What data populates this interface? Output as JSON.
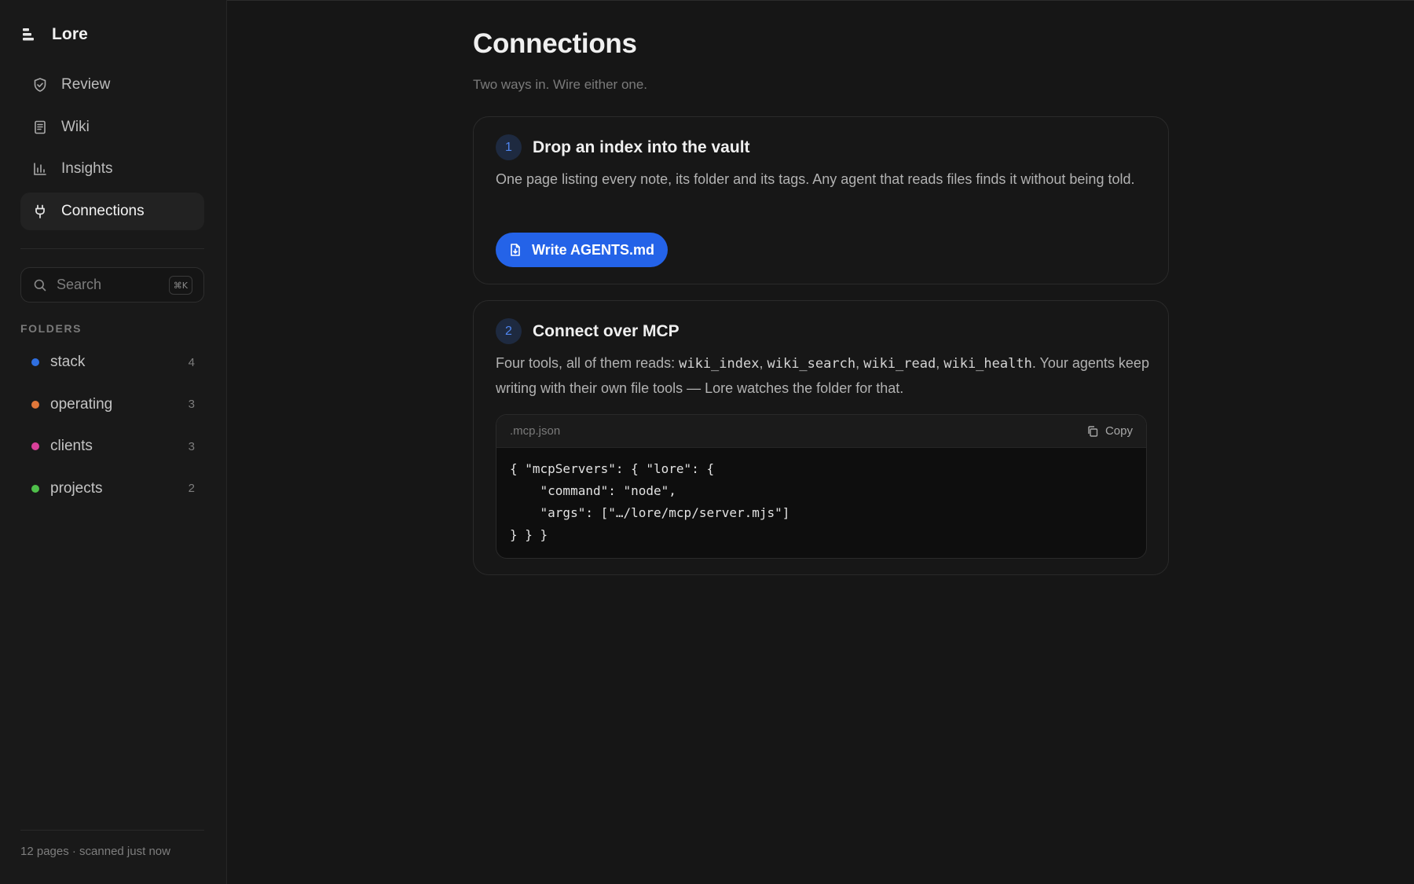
{
  "app": {
    "name": "Lore",
    "logo_icon": "stack-logo-icon"
  },
  "sidebar": {
    "nav": [
      {
        "label": "Review",
        "icon": "shield-check-icon",
        "active": false
      },
      {
        "label": "Wiki",
        "icon": "book-icon",
        "active": false
      },
      {
        "label": "Insights",
        "icon": "bar-chart-icon",
        "active": false
      },
      {
        "label": "Connections",
        "icon": "plug-icon",
        "active": true
      }
    ],
    "search": {
      "placeholder": "Search",
      "shortcut": "⌘K"
    },
    "folders_label": "FOLDERS",
    "folders": [
      {
        "name": "stack",
        "count": "4",
        "color": "#2f6fe0"
      },
      {
        "name": "operating",
        "count": "3",
        "color": "#e0773a"
      },
      {
        "name": "clients",
        "count": "3",
        "color": "#d9409a"
      },
      {
        "name": "projects",
        "count": "2",
        "color": "#4fbf4a"
      }
    ],
    "status": "12 pages · scanned just now"
  },
  "main": {
    "title": "Connections",
    "subtitle": "Two ways in. Wire either one.",
    "step1": {
      "number": "1",
      "title": "Drop an index into the vault",
      "body": "One page listing every note, its folder and its tags. Any agent that reads files finds it without being told.",
      "button_label": "Write AGENTS.md",
      "button_icon": "file-download-icon"
    },
    "step2": {
      "number": "2",
      "title": "Connect over MCP",
      "body_prefix": "Four tools, all of them reads: ",
      "tools": [
        "wiki_index",
        "wiki_search",
        "wiki_read",
        "wiki_health"
      ],
      "sep": ", ",
      "body_suffix": ". Your agents keep writing with their own file tools — Lore watches the folder for that.",
      "code_filename": ".mcp.json",
      "copy_label": "Copy",
      "copy_icon": "copy-icon",
      "code": "{ \"mcpServers\": { \"lore\": {\n    \"command\": \"node\",\n    \"args\": [\"…/lore/mcp/server.mjs\"]\n} } }"
    }
  },
  "colors": {
    "accent": "#2463e8",
    "background": "#161616",
    "sidebar": "#191919"
  }
}
